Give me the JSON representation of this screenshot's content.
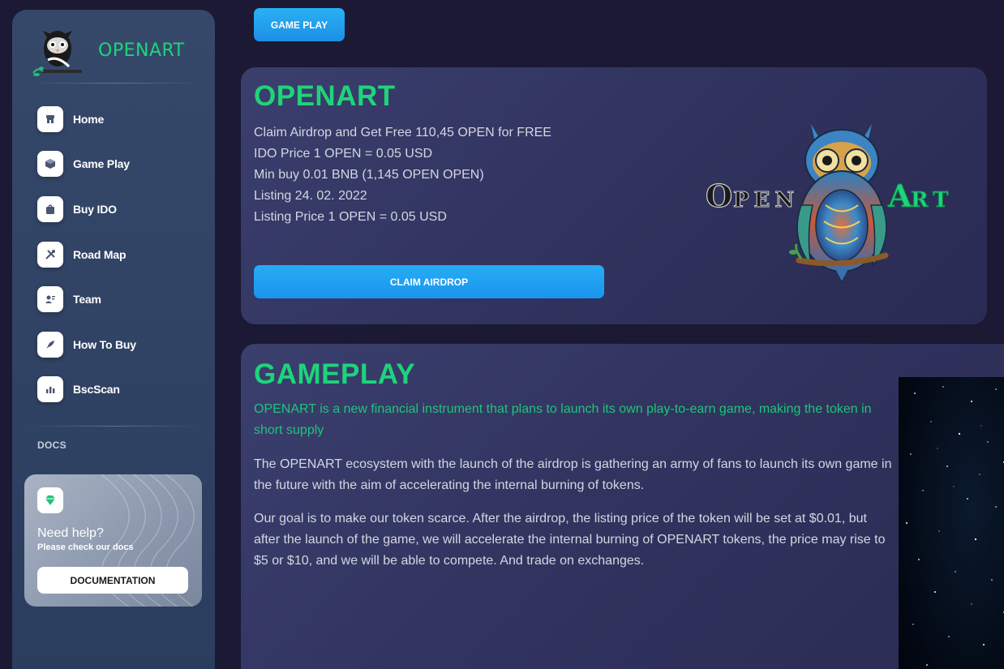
{
  "brand": {
    "name": "OPENART"
  },
  "sidebar": {
    "items": [
      {
        "label": "Home",
        "icon": "store-icon"
      },
      {
        "label": "Game Play",
        "icon": "cube-icon"
      },
      {
        "label": "Buy IDO",
        "icon": "bag-icon"
      },
      {
        "label": "Road Map",
        "icon": "tools-icon"
      },
      {
        "label": "Team",
        "icon": "user-icon"
      },
      {
        "label": "How To Buy",
        "icon": "rocket-icon"
      },
      {
        "label": "BscScan",
        "icon": "chart-icon"
      }
    ],
    "docs_heading": "DOCS",
    "help": {
      "title": "Need help?",
      "subtitle": "Please check our docs",
      "button": "DOCUMENTATION",
      "icon": "diamond-icon"
    }
  },
  "top_button": "GAME PLAY",
  "openart_card": {
    "title": "OPENART",
    "lines": [
      "Claim Airdrop and Get Free 110,45 OPEN for FREE",
      "IDO Price 1 OPEN = 0.05 USD",
      "Min buy 0.01 BNB (1,145 OPEN OPEN)",
      "Listing 24. 02. 2022",
      "Listing Price 1 OPEN = 0.05 USD"
    ],
    "button": "CLAIM AIRDROP",
    "logo_text": "OPEN ART"
  },
  "gameplay_card": {
    "title": "GAMEPLAY",
    "lead": "OPENART is a new financial instrument that plans to launch its own play-to-earn game, making the token in short supply",
    "para1": "The OPENART ecosystem with the launch of the airdrop is gathering an army of fans to launch its own game in the future with the aim of accelerating the internal burning of tokens.",
    "para2": "Our goal is to make our token scarce. After the airdrop, the listing price of the token will be set at $0.01, but after the launch of the game, we will accelerate the internal burning of OPENART tokens, the price may rise to $5 or $10, and we will be able to compete. And trade on exchanges."
  },
  "colors": {
    "accent_green": "#1ed47a",
    "button_blue": "#1d9bf0",
    "background": "#1b1933",
    "sidebar": "#33466a"
  }
}
